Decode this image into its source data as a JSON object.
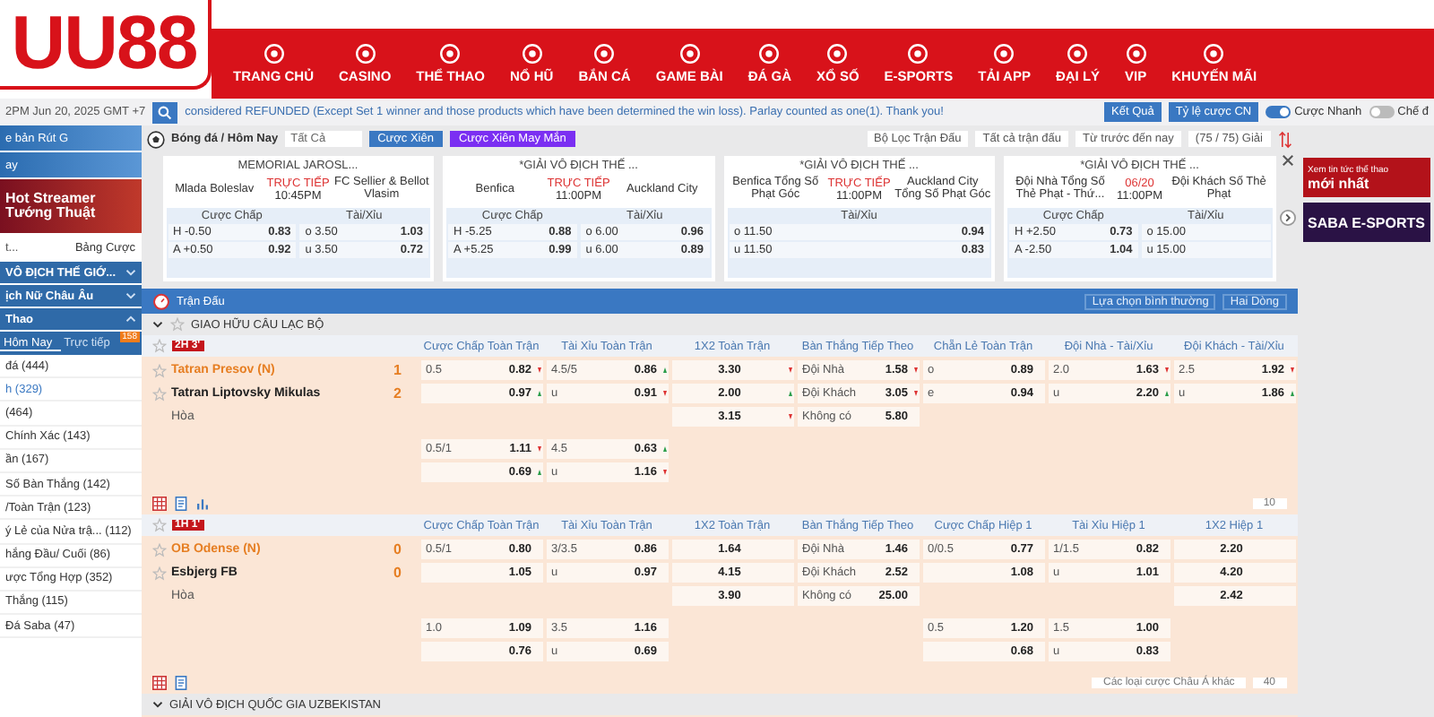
{
  "logo": "UU88",
  "nav": [
    {
      "label": "TRANG CHỦ"
    },
    {
      "label": "CASINO"
    },
    {
      "label": "THỂ THAO"
    },
    {
      "label": "NỔ HŨ"
    },
    {
      "label": "BẮN CÁ"
    },
    {
      "label": "GAME BÀI"
    },
    {
      "label": "ĐÁ GÀ"
    },
    {
      "label": "XỔ SỐ"
    },
    {
      "label": "E-SPORTS"
    },
    {
      "label": "TẢI APP"
    },
    {
      "label": "ĐẠI LÝ"
    },
    {
      "label": "VIP"
    },
    {
      "label": "KHUYẾN MÃI"
    }
  ],
  "info_bar": {
    "clock": "2PM Jun 20, 2025 GMT +7",
    "notice": "considered REFUNDED (Except Set 1 winner and those products which have been determined the win loss). Parlay counted as one(1). Thank you!",
    "buttons": [
      "Kết Quả",
      "Tỷ lệ cược CN"
    ],
    "toggles": [
      {
        "label": "Cược Nhanh",
        "on": true
      },
      {
        "label": "Chế đ",
        "on": false
      }
    ]
  },
  "sidebar": {
    "banners": [
      {
        "text": "e bản Rút G"
      },
      {
        "text": "ay"
      },
      {
        "text": "Hot Streamer Tướng Thuật"
      }
    ],
    "bet_select": "t...",
    "bet_board": "Bảng Cược",
    "sections": [
      {
        "label": "VÔ ĐỊCH THẾ GIỚ...",
        "expanded": false
      },
      {
        "label": "ịch Nữ Châu Âu",
        "expanded": false
      },
      {
        "label": "Thao",
        "expanded": true
      }
    ],
    "tabs": [
      {
        "label": "Hôm Nay",
        "selected": true
      },
      {
        "label": "Trực tiếp",
        "selected": false,
        "badge": "158"
      }
    ],
    "items": [
      {
        "label": "đá (444)",
        "selected": false
      },
      {
        "label": "h (329)",
        "selected": true
      },
      {
        "label": "(464)",
        "selected": false
      },
      {
        "label": "Chính Xác (143)",
        "selected": false
      },
      {
        "label": "ần (167)",
        "selected": false
      },
      {
        "label": "Số Bàn Thắng (142)",
        "selected": false
      },
      {
        "label": "/Toàn Trận (123)",
        "selected": false
      },
      {
        "label": "ý Lẻ của Nửa trậ... (112)",
        "selected": false
      },
      {
        "label": "hắng Đầu/ Cuối (86)",
        "selected": false
      },
      {
        "label": "ược Tổng Hợp (352)",
        "selected": false
      },
      {
        "label": "Thắng (115)",
        "selected": false
      },
      {
        "label": "Đá Saba (47)",
        "selected": false
      }
    ]
  },
  "toolbar": {
    "breadcrumb": "Bóng đá / Hôm Nay",
    "select": "Tất Cả",
    "parlay": "Cược Xiên",
    "lucky_parlay": "Cược Xiên May Mắn",
    "filters": [
      "Bộ Lọc Trận Đấu",
      "Tất cả trận đấu",
      "Từ trước đến nay"
    ],
    "league_count": "(75 / 75) Giải"
  },
  "featured": [
    {
      "league": "MEMORIAL JAROSL...",
      "home": "Mlada Boleslav",
      "status": "TRỰC TIẾP",
      "time": "10:45PM",
      "away": "FC Sellier & Bellot Vlasim",
      "markets": [
        {
          "label": "Cược Chấp",
          "rows": [
            {
              "a": "H -0.50",
              "b": "0.83"
            },
            {
              "a": "A +0.50",
              "b": "0.92"
            }
          ]
        },
        {
          "label": "Tài/Xỉu",
          "rows": [
            {
              "a": "o 3.50",
              "b": "1.03"
            },
            {
              "a": "u 3.50",
              "b": "0.72"
            }
          ]
        }
      ]
    },
    {
      "league": "*GIẢI VÔ ĐỊCH THẾ ...",
      "home": "Benfica",
      "status": "TRỰC TIẾP",
      "time": "11:00PM",
      "away": "Auckland City",
      "markets": [
        {
          "label": "Cược Chấp",
          "rows": [
            {
              "a": "H -5.25",
              "b": "0.88"
            },
            {
              "a": "A +5.25",
              "b": "0.99"
            }
          ]
        },
        {
          "label": "Tài/Xỉu",
          "rows": [
            {
              "a": "o 6.00",
              "b": "0.96"
            },
            {
              "a": "u 6.00",
              "b": "0.89"
            }
          ]
        }
      ]
    },
    {
      "league": "*GIẢI VÔ ĐỊCH THẾ ...",
      "home": "Benfica Tổng Số Phạt Góc",
      "status": "TRỰC TIẾP",
      "time": "11:00PM",
      "away": "Auckland City Tổng Số Phạt Góc",
      "markets": [
        {
          "label": "Tài/Xỉu",
          "rows": [
            {
              "a": "o 11.50",
              "b": "0.94"
            },
            {
              "a": "u 11.50",
              "b": "0.83"
            }
          ]
        }
      ]
    },
    {
      "league": "*GIẢI VÔ ĐỊCH THẾ ...",
      "home": "Đội Nhà Tổng Số Thẻ Phạt - Thứ...",
      "status": "06/20",
      "time": "11:00PM",
      "away": "Đội Khách Số Thẻ Phạt",
      "markets": [
        {
          "label": "Cược Chấp",
          "rows": [
            {
              "a": "H +2.50",
              "b": "0.73"
            },
            {
              "a": "A -2.50",
              "b": "1.04"
            }
          ]
        },
        {
          "label": "Tài/Xỉu",
          "rows": [
            {
              "a": "o 15.00"
            },
            {
              "a": "u 15.00"
            }
          ]
        }
      ]
    }
  ],
  "promos": [
    {
      "kicker": "Xem tin tức thể thao",
      "title": "mới nhất"
    },
    {
      "title": "SABA E-SPORTS"
    }
  ],
  "matches_panel": {
    "title": "Trận Đấu",
    "options": [
      "Lựa chọn bình thường",
      "Hai Dòng"
    ],
    "league": "GIAO HỮU CÂU LẠC BỘ",
    "matches": [
      {
        "clock": "2H 3'",
        "columns": [
          {
            "label": "Cược Chấp Toàn Trận",
            "kind": "pair"
          },
          {
            "label": "Tài Xỉu Toàn Trận",
            "kind": "pair"
          },
          {
            "label": "1X2 Toàn Trận",
            "kind": "single"
          },
          {
            "label": "Bàn Thắng Tiếp Theo",
            "kind": "pair"
          },
          {
            "label": "Chẵn Lẻ Toàn Trận",
            "kind": "pair"
          },
          {
            "label": "Đội Nhà - Tài/Xỉu",
            "kind": "pair"
          },
          {
            "label": "Đội Khách - Tài/Xỉu",
            "kind": "pair"
          }
        ],
        "teams": [
          {
            "kind": "team",
            "name": "Tatran Presov (N)",
            "score": "1",
            "favorite": true
          },
          {
            "kind": "team",
            "name": "Tatran Liptovsky Mikulas",
            "score": "2",
            "favorite": false
          },
          {
            "kind": "draw",
            "name": "Hòa"
          }
        ],
        "lines": [
          [
            [
              {
                "kind": "odds",
                "a": "0.5",
                "b": "0.82",
                "up": false
              },
              {
                "kind": "odds",
                "a": "4.5/5",
                "b": "0.86",
                "up": true
              },
              {
                "kind": "odds",
                "b": "3.30",
                "up": false
              },
              {
                "kind": "odds",
                "a": "Đội Nhà",
                "b": "1.58",
                "up": false
              },
              {
                "kind": "odds",
                "a": "o",
                "b": "0.89"
              },
              {
                "kind": "odds",
                "a": "2.0",
                "b": "1.63",
                "up": false
              },
              {
                "kind": "odds",
                "a": "2.5",
                "b": "1.92",
                "up": false
              }
            ],
            [
              {
                "kind": "odds",
                "b": "0.97",
                "up": true
              },
              {
                "kind": "odds",
                "a": "u",
                "b": "0.91",
                "up": false
              },
              {
                "kind": "odds",
                "b": "2.00",
                "up": true
              },
              {
                "kind": "odds",
                "a": "Đội Khách",
                "b": "3.05",
                "up": false
              },
              {
                "kind": "odds",
                "a": "e",
                "b": "0.94"
              },
              {
                "kind": "odds",
                "a": "u",
                "b": "2.20",
                "up": true
              },
              {
                "kind": "odds",
                "a": "u",
                "b": "1.86",
                "up": true
              }
            ],
            [
              {
                "kind": "blank"
              },
              {
                "kind": "blank"
              },
              {
                "kind": "odds",
                "b": "3.15",
                "up": false
              },
              {
                "kind": "odds",
                "a": "Không có",
                "b": "5.80"
              },
              {
                "kind": "blank"
              },
              {
                "kind": "blank"
              },
              {
                "kind": "blank"
              }
            ]
          ],
          [
            [
              {
                "kind": "odds",
                "a": "0.5/1",
                "b": "1.11",
                "up": false
              },
              {
                "kind": "odds",
                "a": "4.5",
                "b": "0.63",
                "up": true
              },
              {
                "kind": "blank"
              },
              {
                "kind": "blank"
              },
              {
                "kind": "blank"
              },
              {
                "kind": "blank"
              },
              {
                "kind": "blank"
              }
            ],
            [
              {
                "kind": "odds",
                "b": "0.69",
                "up": true
              },
              {
                "kind": "odds",
                "a": "u",
                "b": "1.16",
                "up": false
              },
              {
                "kind": "blank"
              },
              {
                "kind": "blank"
              },
              {
                "kind": "blank"
              },
              {
                "kind": "blank"
              },
              {
                "kind": "blank"
              }
            ]
          ]
        ],
        "tools": [
          {
            "kind": "grid"
          },
          {
            "kind": "sheet"
          },
          {
            "kind": "chart"
          }
        ],
        "selects": [
          "10"
        ]
      },
      {
        "clock": "1H 1'",
        "columns": [
          {
            "label": "Cược Chấp Toàn Trận",
            "kind": "pair"
          },
          {
            "label": "Tài Xỉu Toàn Trận",
            "kind": "pair"
          },
          {
            "label": "1X2 Toàn Trận",
            "kind": "single"
          },
          {
            "label": "Bàn Thắng Tiếp Theo",
            "kind": "pair"
          },
          {
            "label": "Cược Chấp Hiệp 1",
            "kind": "pair"
          },
          {
            "label": "Tài Xỉu Hiệp 1",
            "kind": "pair"
          },
          {
            "label": "1X2 Hiệp 1",
            "kind": "single"
          }
        ],
        "teams": [
          {
            "kind": "team",
            "name": "OB Odense (N)",
            "score": "0",
            "favorite": true
          },
          {
            "kind": "team",
            "name": "Esbjerg FB",
            "score": "0",
            "favorite": false
          },
          {
            "kind": "draw",
            "name": "Hòa"
          }
        ],
        "lines": [
          [
            [
              {
                "kind": "odds",
                "a": "0.5/1",
                "b": "0.80"
              },
              {
                "kind": "odds",
                "a": "3/3.5",
                "b": "0.86"
              },
              {
                "kind": "odds",
                "b": "1.64"
              },
              {
                "kind": "odds",
                "a": "Đội Nhà",
                "b": "1.46"
              },
              {
                "kind": "odds",
                "a": "0/0.5",
                "b": "0.77"
              },
              {
                "kind": "odds",
                "a": "1/1.5",
                "b": "0.82"
              },
              {
                "kind": "odds",
                "b": "2.20"
              }
            ],
            [
              {
                "kind": "odds",
                "b": "1.05"
              },
              {
                "kind": "odds",
                "a": "u",
                "b": "0.97"
              },
              {
                "kind": "odds",
                "b": "4.15"
              },
              {
                "kind": "odds",
                "a": "Đội Khách",
                "b": "2.52"
              },
              {
                "kind": "odds",
                "b": "1.08"
              },
              {
                "kind": "odds",
                "a": "u",
                "b": "1.01"
              },
              {
                "kind": "odds",
                "b": "4.20"
              }
            ],
            [
              {
                "kind": "blank"
              },
              {
                "kind": "blank"
              },
              {
                "kind": "odds",
                "b": "3.90"
              },
              {
                "kind": "odds",
                "a": "Không có",
                "b": "25.00"
              },
              {
                "kind": "blank"
              },
              {
                "kind": "blank"
              },
              {
                "kind": "odds",
                "b": "2.42"
              }
            ]
          ],
          [
            [
              {
                "kind": "odds",
                "a": "1.0",
                "b": "1.09"
              },
              {
                "kind": "odds",
                "a": "3.5",
                "b": "1.16"
              },
              {
                "kind": "blank"
              },
              {
                "kind": "blank"
              },
              {
                "kind": "odds",
                "a": "0.5",
                "b": "1.20"
              },
              {
                "kind": "odds",
                "a": "1.5",
                "b": "1.00"
              },
              {
                "kind": "blank"
              }
            ],
            [
              {
                "kind": "odds",
                "b": "0.76"
              },
              {
                "kind": "odds",
                "a": "u",
                "b": "0.69"
              },
              {
                "kind": "blank"
              },
              {
                "kind": "blank"
              },
              {
                "kind": "odds",
                "b": "0.68"
              },
              {
                "kind": "odds",
                "a": "u",
                "b": "0.83"
              },
              {
                "kind": "blank"
              }
            ]
          ]
        ],
        "tools": [
          {
            "kind": "grid"
          },
          {
            "kind": "sheet"
          }
        ],
        "selects": [
          "Các loại cược Châu Á khác",
          "40"
        ]
      }
    ],
    "next_league": "GIẢI VÔ ĐỊCH QUỐC GIA UZBEKISTAN"
  }
}
